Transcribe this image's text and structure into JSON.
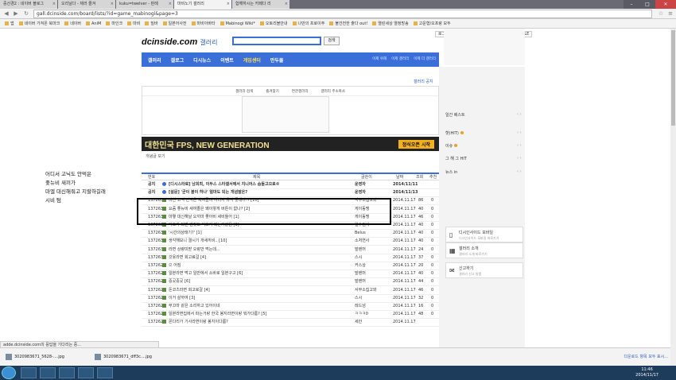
{
  "browser": {
    "tabs": [
      {
        "label": "중산경2 : 네이버 블로그",
        "active": false
      },
      {
        "label": "오리날다 - 제러 즐겨",
        "active": false
      },
      {
        "label": "kuku=twelver - 판례",
        "active": false
      },
      {
        "label": "마비노기 갤러리",
        "active": true
      },
      {
        "label": "합해하시는 카페다 리",
        "active": false
      }
    ],
    "url": "gall.dcinside.com/board/lists/?id=game_mabinogi&page=3",
    "bookmarks": [
      "앱",
      "네이버 가져온 북마크",
      "네이버",
      "AniM",
      "마인크",
      "마비",
      "밀바",
      "일본어사전",
      "마비아바타",
      "Mabinogi Wiki*",
      "오토리블안내",
      "나만의 프로이주",
      "불건전한 출다 out!",
      "열린세상 열정방송",
      "고운형/오프랑 모두"
    ]
  },
  "site": {
    "util_buttons": [
      "로그인하기",
      "갤러리",
      "뉴스",
      "디시",
      "MOBILE"
    ],
    "logo": "dcinside.com",
    "logo_kr": "갤러리",
    "search_button": "검색",
    "nav": [
      "갤러리",
      "갤로그",
      "디시뉴스",
      "이벤트",
      "게임센터",
      "만두몰"
    ],
    "nav_highlight": "게임센터",
    "nav_right": [
      "이제 위해",
      "이제 갤러리",
      "이제 더 갤러리"
    ],
    "gallery_notice_link": "갤러리 공지",
    "gallery_tabs": [
      "갤러리 검색",
      "즐겨찾기",
      "연관갤러리",
      "갤러리 주소복사"
    ],
    "banner_text": "대한민국 FPS, NEW GENERATION",
    "banner_btn": "정식오픈 시작",
    "filter_label": "개념글 보기",
    "list_headers": {
      "no": "번호",
      "title": "제목",
      "author": "글쓴이",
      "date": "날짜",
      "views": "조회",
      "recommend": "추천"
    },
    "posts": [
      {
        "no": "공지",
        "title": "[디시스타로] 남희최, 이두스 스타갤서에서 지니어스 숨들고으로©",
        "author": "운영자",
        "date": "2014/11/11",
        "views": "",
        "rec": "",
        "notice": true
      },
      {
        "no": "공지",
        "title": "[설문] '굳이 볼이 하나' 얼마도 되는 개념발은?",
        "author": "운영자",
        "date": "2014/11/13",
        "views": "",
        "rec": "",
        "notice": true
      },
      {
        "no": "1372637",
        "title": "미친 고닉 안먹은 세여졸이 어디서 유막 좋내나!? [10]",
        "author": "서무소집고와",
        "date": "2014.11.17",
        "views": "86",
        "rec": "0",
        "notice": false
      },
      {
        "no": "1372636",
        "title": "요즘 좋뉴비 새여졸은 왜이렇게 버튼이 없나? [2]",
        "author": "게이동맹",
        "date": "2014.11.17",
        "views": "40",
        "rec": "0",
        "notice": false
      },
      {
        "no": "1372635",
        "title": "마몋 대신해날 오끼마 좋아비 세비들어 [1]",
        "author": "게이동맹",
        "date": "2014.11.17",
        "views": "46",
        "rec": "0",
        "notice": false
      },
      {
        "no": "1372634",
        "title": "익호가 되면 엄짓도 익호가 되는거같음 [3]",
        "author": "일수검사",
        "date": "2014.11.17",
        "views": "40",
        "rec": "0",
        "notice": false
      },
      {
        "no": "1372633",
        "title": "'시간의상태기?' [1]",
        "author": "Belus",
        "date": "2014.11.17",
        "views": "40",
        "rec": "0",
        "notice": false
      },
      {
        "no": "1372632",
        "title": "생각해보니 결시기 개새끼비.. [10]",
        "author": "소처연사",
        "date": "2014.11.17",
        "views": "40",
        "rec": "0",
        "notice": false
      },
      {
        "no": "1372631",
        "title": "라면 상량미받 오랑만 먹는데...",
        "author": "발렌머",
        "date": "2014.11.17",
        "views": "24",
        "rec": "0",
        "notice": false
      },
      {
        "no": "1372630",
        "title": "갓옷라면 회고료걸 [4]",
        "author": "스시",
        "date": "2014.11.17",
        "views": "37",
        "rec": "0",
        "notice": false
      },
      {
        "no": "1372629",
        "title": "으 어짐",
        "author": "커스상",
        "date": "2014.11.17",
        "views": "20",
        "rec": "0",
        "notice": false
      },
      {
        "no": "1372628",
        "title": "일본라면 먹고 일반에서 소바로 일본구고 [6]",
        "author": "발렌머",
        "date": "2014.11.17",
        "views": "40",
        "rec": "0",
        "notice": false
      },
      {
        "no": "1372627",
        "title": "중곳중곳 [6]",
        "author": "발렌머",
        "date": "2014.11.17",
        "views": "44",
        "rec": "0",
        "notice": false
      },
      {
        "no": "1372626",
        "title": "돈코츠라면 회고로갈 [4]",
        "author": "서무소집고와",
        "date": "2014.11.17",
        "views": "46",
        "rec": "0",
        "notice": false
      },
      {
        "no": "1372625",
        "title": "이거 살까여 [3]",
        "author": "스시",
        "date": "2014.11.17",
        "views": "32",
        "rec": "0",
        "notice": false
      },
      {
        "no": "1372624",
        "title": "부끄마 같은 소리하고 있어이네",
        "author": "레드넘",
        "date": "2014.11.17",
        "views": "16",
        "rec": "0",
        "notice": false
      },
      {
        "no": "1372623",
        "title": "일본라면집에서 파는거랑 한국 봉지라면이랑 뭐가다름? [5]",
        "author": "ㅋㅋㅋ0",
        "date": "2014.11.17",
        "views": "48",
        "rec": "0",
        "notice": false
      },
      {
        "no": "1372622",
        "title": "몬다리가 기사라면이랑 봉지이다름?",
        "author": "세안",
        "date": "2014.11.17",
        "views": "",
        "rec": "",
        "notice": false
      }
    ],
    "right_panel": {
      "items": [
        {
          "label": "일간 베스트",
          "dot": false
        },
        {
          "label": "핫(HIT)",
          "dot": true
        },
        {
          "label": "이슈",
          "dot": true
        },
        {
          "label": "그 해 그 HIT",
          "dot": false
        },
        {
          "label": "뉴스 in",
          "dot": false
        }
      ],
      "cards": [
        {
          "title": "디시인사이드 모바일",
          "sub": "디시인사이드 모바일 바로가기",
          "icon": "phone-icon"
        },
        {
          "title": "갤러리 소개",
          "sub": "갤러리 소개 바로가기",
          "icon": "gallery-icon"
        },
        {
          "title": "신고하기",
          "sub": "갤러리 신고 방법",
          "icon": "megaphone-icon"
        }
      ]
    }
  },
  "annotation": [
    "어디서 고닉도 안먹은",
    "좆뉴비 새끼가",
    "마엘 대신해줘고 지랄하길래",
    "시비 텀"
  ],
  "status_text": "adde.dcinside.com의 응답을 기다리는 중...",
  "downloads": [
    "3020983671_5628-....jpg",
    "3020983671_dff3c....jpg"
  ],
  "downloads_right": "다운로드 항목 모두 표시...",
  "clock": {
    "time": "11:46",
    "date": "2014/11/17"
  }
}
